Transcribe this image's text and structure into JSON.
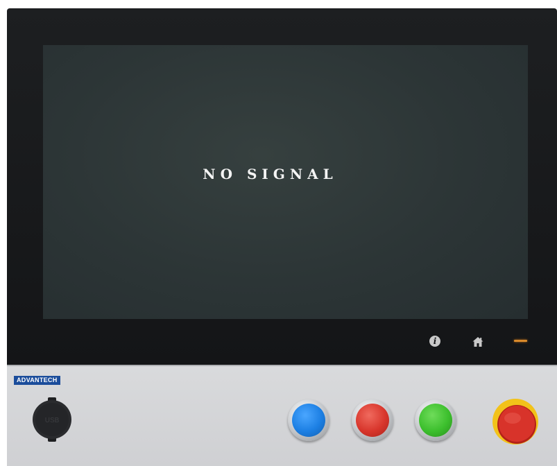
{
  "screen": {
    "message": "NO SIGNAL"
  },
  "touch_keys": {
    "info_glyph": "i",
    "info_icon": "info-icon",
    "home_icon": "home-icon",
    "led_color": "#d98a2b"
  },
  "panel": {
    "brand": "ADVANTECH",
    "brand_color": "#1b4d9b",
    "usb_label": "USB",
    "buttons": [
      {
        "name": "blue-pushbutton",
        "color": "#1c7fe3"
      },
      {
        "name": "red-pushbutton",
        "color": "#d8362c"
      },
      {
        "name": "green-pushbutton",
        "color": "#3cbf2d"
      },
      {
        "name": "emergency-stop-button",
        "color": "#d8362c"
      }
    ]
  }
}
